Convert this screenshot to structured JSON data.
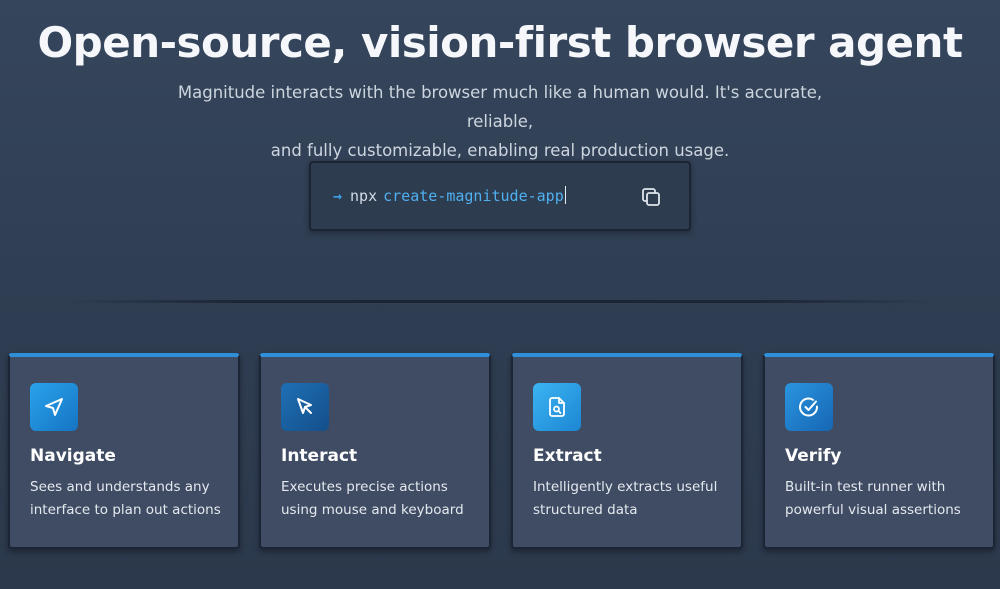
{
  "hero": {
    "title": "Open-source, vision-first browser agent",
    "subtitle_line1": "Magnitude interacts with the browser much like a human would. It's accurate, reliable,",
    "subtitle_line2": "and fully customizable, enabling real production usage."
  },
  "command": {
    "arrow": "→",
    "prefix": "npx",
    "package": "create-magnitude-app",
    "copy_icon": "copy-icon"
  },
  "features": [
    {
      "title": "Navigate",
      "desc_line1": "Sees and understands any",
      "desc_line2": "interface to plan out actions",
      "icon": "navigation-arrow-icon"
    },
    {
      "title": "Interact",
      "desc_line1": "Executes precise actions",
      "desc_line2": "using mouse and keyboard",
      "icon": "mouse-pointer-icon"
    },
    {
      "title": "Extract",
      "desc_line1": "Intelligently extracts useful",
      "desc_line2": "structured data",
      "icon": "file-search-icon"
    },
    {
      "title": "Verify",
      "desc_line1": "Built-in test runner with",
      "desc_line2": "powerful visual assertions",
      "icon": "check-circle-icon"
    }
  ],
  "colors": {
    "accent": "#2f8fd8",
    "command_package": "#4fb0f0",
    "background": "#35455b",
    "card": "#3f4c63"
  }
}
